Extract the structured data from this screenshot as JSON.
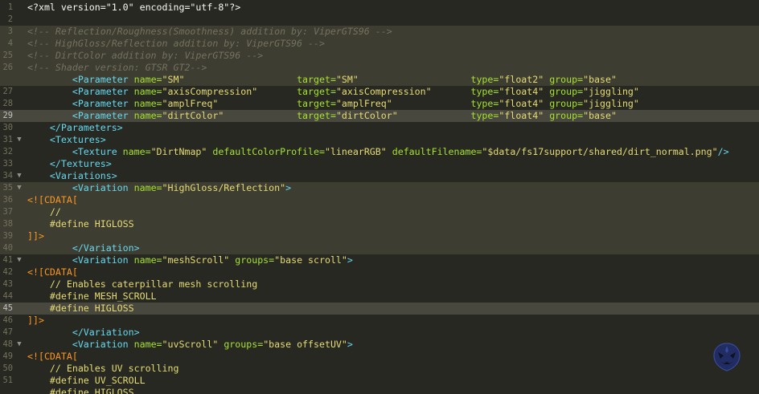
{
  "editor": {
    "language": "xml",
    "lines": [
      {
        "n": "1",
        "fold": "",
        "hl": "",
        "segs": [
          {
            "t": "text",
            "v": "<?xml version=\"1.0\" encoding=\"utf-8\"?>"
          }
        ]
      },
      {
        "n": "2",
        "fold": "",
        "hl": "",
        "segs": []
      },
      {
        "n": "3",
        "fold": "",
        "hl": "hl",
        "segs": [
          {
            "t": "comment",
            "v": "<!-- Reflection/Roughness(Smoothness) addition by: ViperGTS96 -->"
          }
        ]
      },
      {
        "n": "4",
        "fold": "",
        "hl": "hl",
        "segs": [
          {
            "t": "comment",
            "v": "<!-- HighGloss/Reflection addition by: ViperGTS96 -->"
          }
        ]
      },
      {
        "n": "25",
        "fold": "",
        "hl": "hl",
        "segs": [
          {
            "t": "comment",
            "v": "<!-- DirtColor addition by: ViperGTS96 -->"
          }
        ]
      },
      {
        "n": "26",
        "fold": "",
        "hl": "hl",
        "segs": [
          {
            "t": "comment",
            "v": "<!-- Shader version: GTSR GT2-->"
          }
        ]
      },
      {
        "n": "",
        "fold": "",
        "hl": "hl",
        "segs": [
          {
            "t": "text",
            "v": "        "
          },
          {
            "t": "tag",
            "v": "<Parameter "
          },
          {
            "t": "attr",
            "v": "name="
          },
          {
            "t": "str",
            "v": "\"SM\"                    "
          },
          {
            "t": "attr",
            "v": "target="
          },
          {
            "t": "str",
            "v": "\"SM\"                    "
          },
          {
            "t": "attr",
            "v": "type="
          },
          {
            "t": "str",
            "v": "\"float2\" "
          },
          {
            "t": "attr",
            "v": "group="
          },
          {
            "t": "str",
            "v": "\"base\""
          }
        ]
      },
      {
        "n": "27",
        "fold": "",
        "hl": "",
        "segs": [
          {
            "t": "text",
            "v": "        "
          },
          {
            "t": "tag",
            "v": "<Parameter "
          },
          {
            "t": "attr",
            "v": "name="
          },
          {
            "t": "str",
            "v": "\"axisCompression\"       "
          },
          {
            "t": "attr",
            "v": "target="
          },
          {
            "t": "str",
            "v": "\"axisCompression\"       "
          },
          {
            "t": "attr",
            "v": "type="
          },
          {
            "t": "str",
            "v": "\"float4\" "
          },
          {
            "t": "attr",
            "v": "group="
          },
          {
            "t": "str",
            "v": "\"jiggling\""
          }
        ]
      },
      {
        "n": "28",
        "fold": "",
        "hl": "",
        "segs": [
          {
            "t": "text",
            "v": "        "
          },
          {
            "t": "tag",
            "v": "<Parameter "
          },
          {
            "t": "attr",
            "v": "name="
          },
          {
            "t": "str",
            "v": "\"amplFreq\"              "
          },
          {
            "t": "attr",
            "v": "target="
          },
          {
            "t": "str",
            "v": "\"amplFreq\"              "
          },
          {
            "t": "attr",
            "v": "type="
          },
          {
            "t": "str",
            "v": "\"float4\" "
          },
          {
            "t": "attr",
            "v": "group="
          },
          {
            "t": "str",
            "v": "\"jiggling\""
          }
        ]
      },
      {
        "n": "29",
        "fold": "",
        "hl": "sel",
        "segs": [
          {
            "t": "text",
            "v": "        "
          },
          {
            "t": "tag",
            "v": "<Parameter "
          },
          {
            "t": "attr",
            "v": "name="
          },
          {
            "t": "str",
            "v": "\"dirtColor\"             "
          },
          {
            "t": "attr",
            "v": "target="
          },
          {
            "t": "str",
            "v": "\"dirtColor\"             "
          },
          {
            "t": "attr",
            "v": "type="
          },
          {
            "t": "str",
            "v": "\"float4\" "
          },
          {
            "t": "attr",
            "v": "group="
          },
          {
            "t": "str",
            "v": "\"base\""
          }
        ]
      },
      {
        "n": "30",
        "fold": "",
        "hl": "",
        "segs": [
          {
            "t": "text",
            "v": "    "
          },
          {
            "t": "tag",
            "v": "</Parameters>"
          }
        ]
      },
      {
        "n": "31",
        "fold": "▼",
        "hl": "",
        "segs": [
          {
            "t": "text",
            "v": "    "
          },
          {
            "t": "tag",
            "v": "<Textures>"
          }
        ]
      },
      {
        "n": "32",
        "fold": "",
        "hl": "",
        "segs": [
          {
            "t": "text",
            "v": "        "
          },
          {
            "t": "tag",
            "v": "<Texture "
          },
          {
            "t": "attr",
            "v": "name="
          },
          {
            "t": "str",
            "v": "\"DirtNmap\" "
          },
          {
            "t": "attr",
            "v": "defaultColorProfile="
          },
          {
            "t": "str",
            "v": "\"linearRGB\" "
          },
          {
            "t": "attr",
            "v": "defaultFilename="
          },
          {
            "t": "str",
            "v": "\"$data/fs17support/shared/dirt_normal.png\""
          },
          {
            "t": "tag",
            "v": "/>"
          }
        ]
      },
      {
        "n": "33",
        "fold": "",
        "hl": "",
        "segs": [
          {
            "t": "text",
            "v": "    "
          },
          {
            "t": "tag",
            "v": "</Textures>"
          }
        ]
      },
      {
        "n": "34",
        "fold": "▼",
        "hl": "",
        "segs": [
          {
            "t": "text",
            "v": "    "
          },
          {
            "t": "tag",
            "v": "<Variations>"
          }
        ]
      },
      {
        "n": "35",
        "fold": "▼",
        "hl": "hl",
        "segs": [
          {
            "t": "text",
            "v": "        "
          },
          {
            "t": "tag",
            "v": "<Variation "
          },
          {
            "t": "attr",
            "v": "name="
          },
          {
            "t": "str",
            "v": "\"HighGloss/Reflection\""
          },
          {
            "t": "tag",
            "v": ">"
          }
        ]
      },
      {
        "n": "36",
        "fold": "",
        "hl": "hl",
        "segs": [
          {
            "t": "cdata",
            "v": "<![CDATA["
          }
        ]
      },
      {
        "n": "37",
        "fold": "",
        "hl": "hl",
        "segs": [
          {
            "t": "pre",
            "v": "    //"
          }
        ]
      },
      {
        "n": "38",
        "fold": "",
        "hl": "hl",
        "segs": [
          {
            "t": "pre",
            "v": "    #define HIGLOSS"
          }
        ]
      },
      {
        "n": "39",
        "fold": "",
        "hl": "hl",
        "segs": [
          {
            "t": "cdata",
            "v": "]]>"
          }
        ]
      },
      {
        "n": "40",
        "fold": "",
        "hl": "hl",
        "segs": [
          {
            "t": "text",
            "v": "        "
          },
          {
            "t": "tag",
            "v": "</Variation>"
          }
        ]
      },
      {
        "n": "41",
        "fold": "▼",
        "hl": "",
        "segs": [
          {
            "t": "text",
            "v": "        "
          },
          {
            "t": "tag",
            "v": "<Variation "
          },
          {
            "t": "attr",
            "v": "name="
          },
          {
            "t": "str",
            "v": "\"meshScroll\" "
          },
          {
            "t": "attr",
            "v": "groups="
          },
          {
            "t": "str",
            "v": "\"base scroll\""
          },
          {
            "t": "tag",
            "v": ">"
          }
        ]
      },
      {
        "n": "42",
        "fold": "",
        "hl": "",
        "segs": [
          {
            "t": "cdata",
            "v": "<![CDATA["
          }
        ]
      },
      {
        "n": "43",
        "fold": "",
        "hl": "",
        "segs": [
          {
            "t": "pre",
            "v": "    // Enables caterpillar mesh scrolling"
          }
        ]
      },
      {
        "n": "44",
        "fold": "",
        "hl": "",
        "segs": [
          {
            "t": "pre",
            "v": "    #define MESH_SCROLL"
          }
        ]
      },
      {
        "n": "45",
        "fold": "",
        "hl": "sel",
        "segs": [
          {
            "t": "pre",
            "v": "    #define HIGLOSS"
          }
        ]
      },
      {
        "n": "46",
        "fold": "",
        "hl": "",
        "segs": [
          {
            "t": "cdata",
            "v": "]]>"
          }
        ]
      },
      {
        "n": "47",
        "fold": "",
        "hl": "",
        "segs": [
          {
            "t": "text",
            "v": "        "
          },
          {
            "t": "tag",
            "v": "</Variation>"
          }
        ]
      },
      {
        "n": "48",
        "fold": "▼",
        "hl": "",
        "segs": [
          {
            "t": "text",
            "v": "        "
          },
          {
            "t": "tag",
            "v": "<Variation "
          },
          {
            "t": "attr",
            "v": "name="
          },
          {
            "t": "str",
            "v": "\"uvScroll\" "
          },
          {
            "t": "attr",
            "v": "groups="
          },
          {
            "t": "str",
            "v": "\"base offsetUV\""
          },
          {
            "t": "tag",
            "v": ">"
          }
        ]
      },
      {
        "n": "49",
        "fold": "",
        "hl": "",
        "segs": [
          {
            "t": "cdata",
            "v": "<![CDATA["
          }
        ]
      },
      {
        "n": "50",
        "fold": "",
        "hl": "",
        "segs": [
          {
            "t": "pre",
            "v": "    // Enables UV scrolling"
          }
        ]
      },
      {
        "n": "51",
        "fold": "",
        "hl": "",
        "segs": [
          {
            "t": "pre",
            "v": "    #define UV_SCROLL"
          }
        ]
      },
      {
        "n": "",
        "fold": "",
        "hl": "",
        "segs": [
          {
            "t": "pre",
            "v": "    #define HIGLOSS"
          }
        ]
      }
    ]
  },
  "logo": {
    "icon": "viper-snake-logo-icon",
    "color": "#2a3a8a"
  }
}
